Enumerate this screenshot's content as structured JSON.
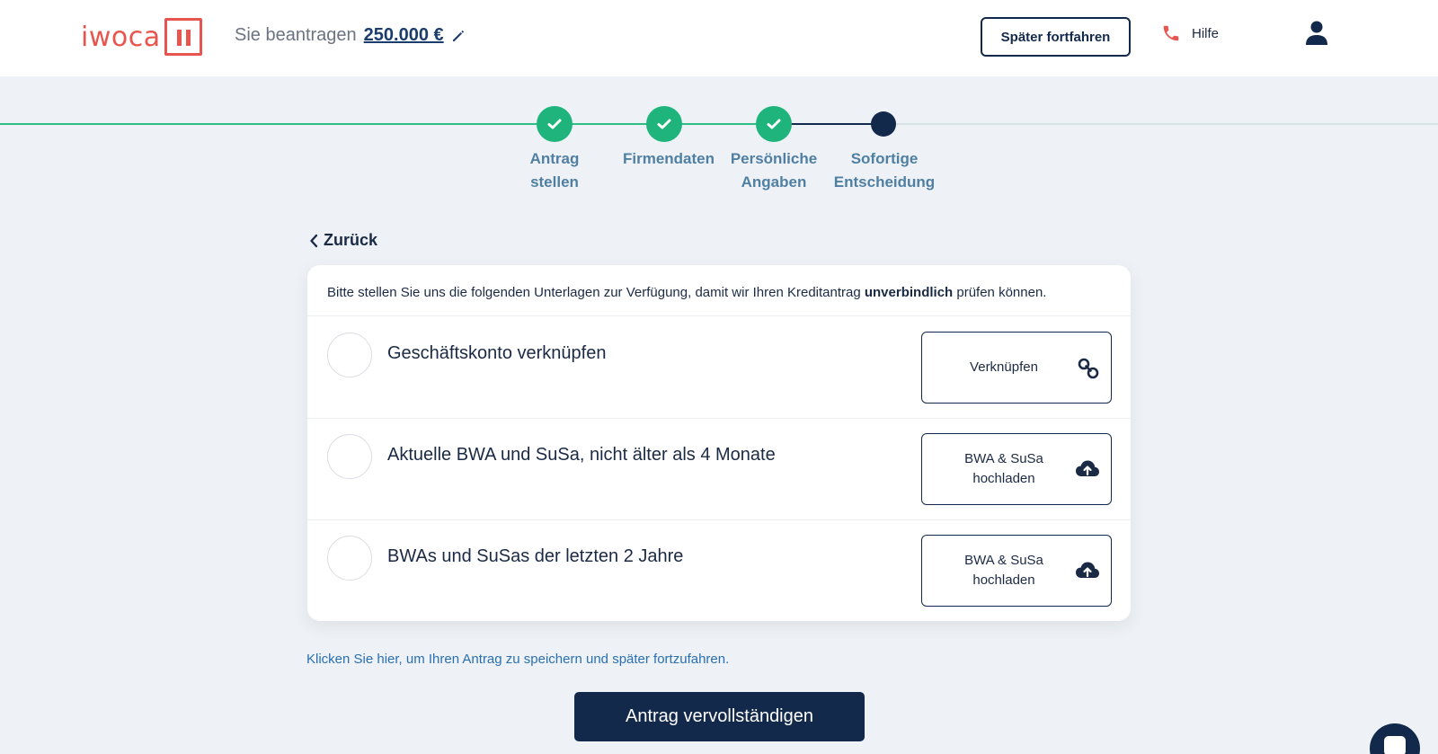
{
  "header": {
    "logo_text": "iwoca",
    "applied_label": "Sie beantragen",
    "applied_amount": "250.000 €",
    "later_button": "Später fortfahren",
    "help_label": "Hilfe"
  },
  "stepper": {
    "steps": [
      {
        "line1": "Antrag",
        "line2": "stellen",
        "status": "done"
      },
      {
        "line1": "Firmendaten",
        "line2": "",
        "status": "done"
      },
      {
        "line1": "Persönliche",
        "line2": "Angaben",
        "status": "done"
      },
      {
        "line1": "Sofortige",
        "line2": "Entscheidung",
        "status": "current"
      }
    ]
  },
  "back_label": "Zurück",
  "card": {
    "intro_before": "Bitte stellen Sie uns die folgenden Unterlagen zur Verfügung, damit wir Ihren Kreditantrag ",
    "intro_bold": "unverbindlich",
    "intro_after": " prüfen können.",
    "rows": [
      {
        "label": "Geschäftskonto verknüpfen",
        "button_line1": "Verknüpfen",
        "button_line2": "",
        "icon": "link-icon"
      },
      {
        "label": "Aktuelle BWA und SuSa, nicht älter als 4 Monate",
        "button_line1": "BWA & SuSa",
        "button_line2": "hochladen",
        "icon": "cloud-upload-icon"
      },
      {
        "label": "BWAs und SuSas der letzten 2 Jahre",
        "button_line1": "BWA & SuSa",
        "button_line2": "hochladen",
        "icon": "cloud-upload-icon"
      }
    ]
  },
  "save_link": "Klicken Sie hier, um Ihren Antrag zu speichern und später fortzufahren.",
  "submit_button": "Antrag vervollständigen",
  "colors": {
    "brand_red": "#e8554e",
    "navy": "#13294b",
    "success_green": "#1fb47b",
    "link_blue": "#2a6fb0",
    "background": "#eef2f6"
  }
}
